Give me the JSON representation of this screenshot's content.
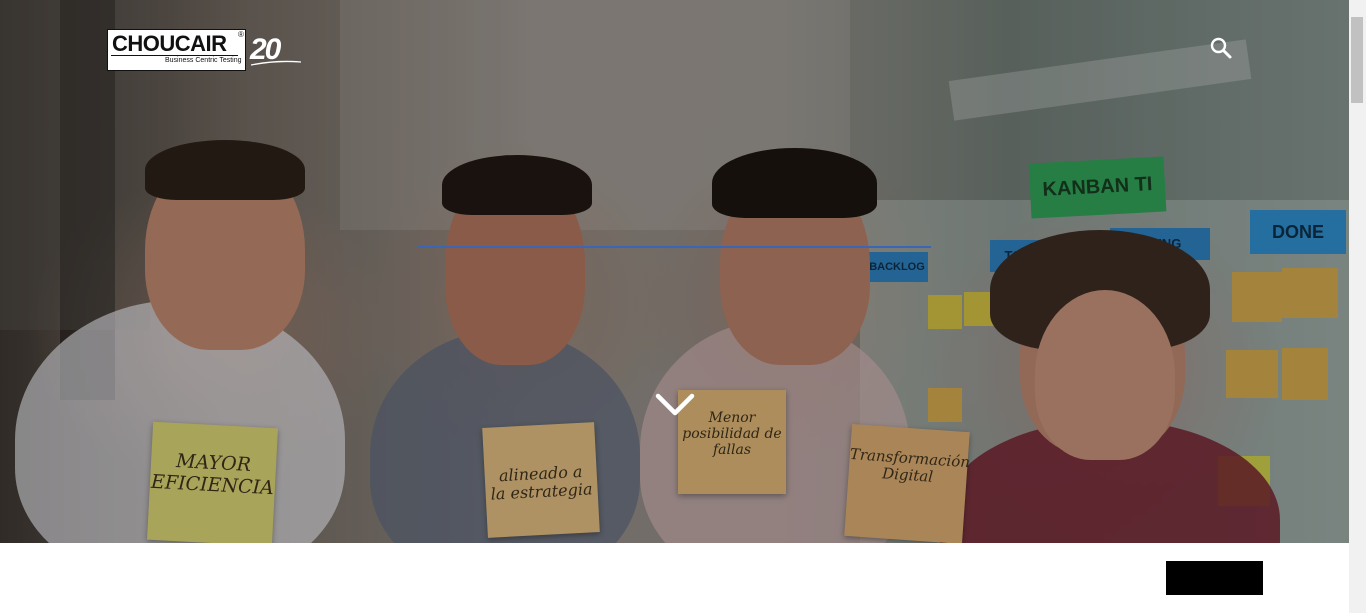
{
  "header": {
    "logo": {
      "brand": "CHOUCAIR",
      "registered": "®",
      "tagline": "Business Centric Testing",
      "anniversary": "20"
    },
    "search_icon": "search-icon"
  },
  "hero": {
    "notes": [
      "MAYOR\nEFICIENCIA",
      "alineado a\nla estrategia",
      "Menor\nposibilidad de\nfallas",
      "Transformación\nDigital"
    ],
    "kanban": {
      "title": "KANBAN TI",
      "columns": [
        "BACKLOG",
        "TO DO",
        "DOING",
        "DONE"
      ]
    },
    "scroll_icon": "chevron-down-icon",
    "progress_color": "#3a66b5"
  },
  "footer": {
    "button_label": ""
  },
  "colors": {
    "accent": "#3a66b5",
    "button": "#000000"
  }
}
